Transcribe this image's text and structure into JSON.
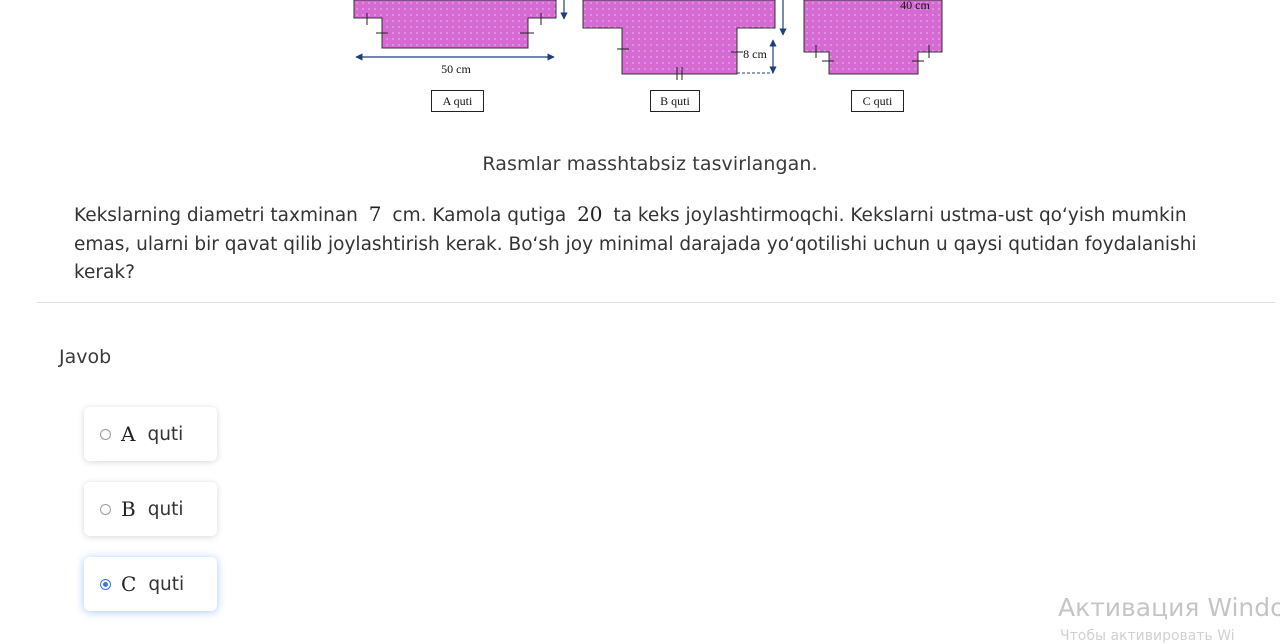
{
  "figure": {
    "dimensions": {
      "a_width": "50 cm",
      "b_depth": "8 cm",
      "c_width": "40 cm"
    },
    "box_labels": [
      "A quti",
      "B quti",
      "C quti"
    ],
    "fill_color": "#d46ad2"
  },
  "caption": "Rasmlar masshtabsiz tasvirlangan.",
  "question": {
    "part1": "Kekslarning diametri taxminan",
    "num1": "7",
    "part2": "cm. Kamola qutiga",
    "num2": "20",
    "part3": "ta keks joylashtirmoqchi. Kekslarni ustma-ust qo‘yish mumkin emas, ularni bir qavat qilib joylashtirish kerak. Bo‘sh joy minimal darajada yo‘qotilishi uchun u qaysi qutidan foydalanishi kerak?"
  },
  "answer": {
    "title": "Javob",
    "options": [
      {
        "letter": "A",
        "text": "quti",
        "selected": false
      },
      {
        "letter": "B",
        "text": "quti",
        "selected": false
      },
      {
        "letter": "C",
        "text": "quti",
        "selected": true
      }
    ]
  },
  "watermark": {
    "line1": "Активация Windo",
    "line2": "Чтобы активировать Wi"
  },
  "colors": {
    "accent": "#3a78e7",
    "box_fill": "#d46ad2",
    "arrow": "#1f3f7a"
  }
}
